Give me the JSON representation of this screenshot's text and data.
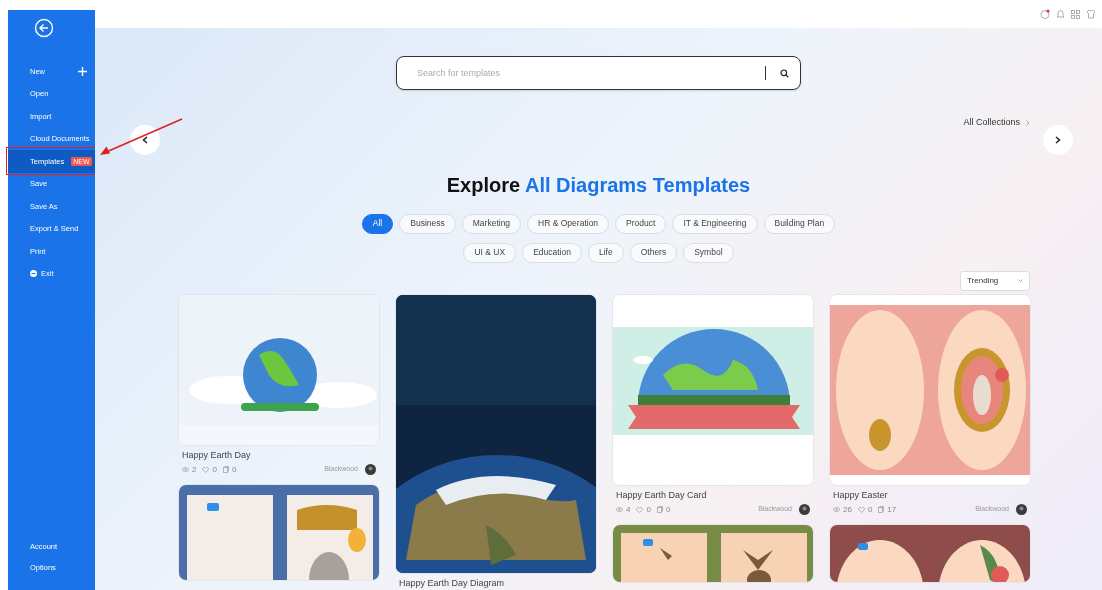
{
  "sidebar": {
    "items": [
      {
        "kind": "add",
        "label": "New",
        "selected": false
      },
      {
        "kind": "plain",
        "label": "Open",
        "selected": false
      },
      {
        "kind": "plain",
        "label": "Import",
        "selected": false
      },
      {
        "kind": "plain",
        "label": "Cloud Documents",
        "selected": false
      },
      {
        "kind": "badge",
        "label": "Templates",
        "badge": "NEW",
        "selected": true
      },
      {
        "kind": "plain",
        "label": "Save",
        "selected": false
      },
      {
        "kind": "plain",
        "label": "Save As",
        "selected": false
      },
      {
        "kind": "plain",
        "label": "Export & Send",
        "selected": false
      },
      {
        "kind": "plain",
        "label": "Print",
        "selected": false
      },
      {
        "kind": "exit",
        "label": "Exit",
        "selected": false
      }
    ],
    "bottom_items": [
      {
        "label": "Account"
      },
      {
        "label": "Options"
      }
    ]
  },
  "search": {
    "placeholder": "Search for templates"
  },
  "all_collections": "All Collections",
  "heading": {
    "text": "Explore",
    "highlight": "All Diagrams Templates"
  },
  "categories": [
    {
      "label": "All",
      "selected": true
    },
    {
      "label": "Business",
      "selected": false
    },
    {
      "label": "Marketing",
      "selected": false
    },
    {
      "label": "HR & Operation",
      "selected": false
    },
    {
      "label": "Product",
      "selected": false
    },
    {
      "label": "IT & Engineering",
      "selected": false
    },
    {
      "label": "Building Plan",
      "selected": false
    },
    {
      "label": "UI & UX",
      "selected": false
    },
    {
      "label": "Education",
      "selected": false
    },
    {
      "label": "Life",
      "selected": false
    },
    {
      "label": "Others",
      "selected": false
    },
    {
      "label": "Symbol",
      "selected": false
    }
  ],
  "sort": {
    "value": "Trending"
  },
  "columns": [
    [
      {
        "kind": "template",
        "title": "Happy Earth Day",
        "views": "2",
        "likes": "0",
        "copies": "0",
        "author": "Blackwood"
      },
      {
        "kind": "template"
      }
    ],
    [
      {
        "kind": "template",
        "title": "Happy Earth Day Diagram"
      }
    ],
    [
      {
        "kind": "template",
        "title": "Happy Earth Day Card",
        "views": "4",
        "likes": "0",
        "copies": "0",
        "author": "Blackwood"
      },
      {
        "kind": "template"
      }
    ],
    [
      {
        "kind": "template",
        "title": "Happy Easter",
        "views": "26",
        "likes": "0",
        "copies": "17",
        "author": "Blackwood"
      },
      {
        "kind": "template"
      }
    ]
  ]
}
